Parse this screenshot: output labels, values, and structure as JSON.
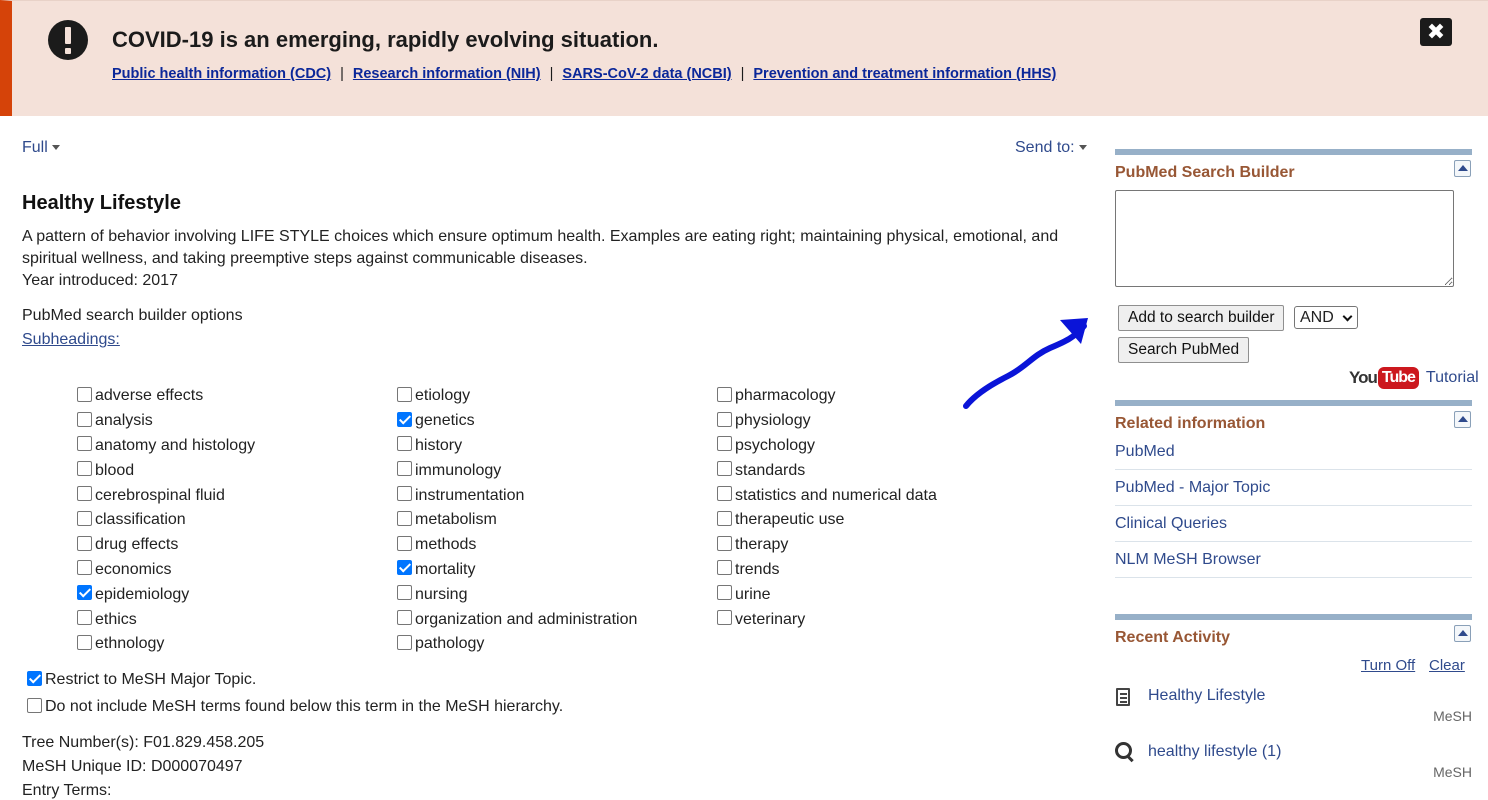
{
  "banner": {
    "title": "COVID-19 is an emerging, rapidly evolving situation.",
    "links": [
      "Public health information (CDC)",
      "Research information (NIH)",
      "SARS-CoV-2 data (NCBI)",
      "Prevention and treatment information (HHS)"
    ],
    "separator": "|",
    "close_label": "✖",
    "accent_color": "#d54309",
    "background_color": "#f4e1d9"
  },
  "toolbar": {
    "format_label": "Full",
    "send_to_label": "Send to:"
  },
  "record": {
    "title": "Healthy Lifestyle",
    "description": "A pattern of behavior involving LIFE STYLE choices which ensure optimum health. Examples are eating right; maintaining physical, emotional, and spiritual wellness, and taking preemptive steps against communicable diseases.",
    "year_introduced": "Year introduced: 2017",
    "builder_options_label": "PubMed search builder options",
    "subheadings_label": "Subheadings:",
    "subheadings": [
      [
        {
          "label": "adverse effects",
          "checked": false
        },
        {
          "label": "analysis",
          "checked": false
        },
        {
          "label": "anatomy and histology",
          "checked": false
        },
        {
          "label": "blood",
          "checked": false
        },
        {
          "label": "cerebrospinal fluid",
          "checked": false
        },
        {
          "label": "classification",
          "checked": false
        },
        {
          "label": "drug effects",
          "checked": false
        },
        {
          "label": "economics",
          "checked": false
        },
        {
          "label": "epidemiology",
          "checked": true
        },
        {
          "label": "ethics",
          "checked": false
        },
        {
          "label": "ethnology",
          "checked": false
        }
      ],
      [
        {
          "label": "etiology",
          "checked": false
        },
        {
          "label": "genetics",
          "checked": true
        },
        {
          "label": "history",
          "checked": false
        },
        {
          "label": "immunology",
          "checked": false
        },
        {
          "label": "instrumentation",
          "checked": false
        },
        {
          "label": "metabolism",
          "checked": false
        },
        {
          "label": "methods",
          "checked": false
        },
        {
          "label": "mortality",
          "checked": true
        },
        {
          "label": "nursing",
          "checked": false
        },
        {
          "label": "organization and administration",
          "checked": false
        },
        {
          "label": "pathology",
          "checked": false
        }
      ],
      [
        {
          "label": "pharmacology",
          "checked": false
        },
        {
          "label": "physiology",
          "checked": false
        },
        {
          "label": "psychology",
          "checked": false
        },
        {
          "label": "standards",
          "checked": false
        },
        {
          "label": "statistics and numerical data",
          "checked": false
        },
        {
          "label": "therapeutic use",
          "checked": false
        },
        {
          "label": "therapy",
          "checked": false
        },
        {
          "label": "trends",
          "checked": false
        },
        {
          "label": "urine",
          "checked": false
        },
        {
          "label": "veterinary",
          "checked": false
        }
      ]
    ],
    "restrict_major_topic": {
      "label": "Restrict to MeSH Major Topic.",
      "checked": true
    },
    "exclude_below": {
      "label": "Do not include MeSH terms found below this term in the MeSH hierarchy.",
      "checked": false
    },
    "tree_number": "Tree Number(s): F01.829.458.205",
    "unique_id": "MeSH Unique ID: D000070497",
    "entry_terms_partial": "Entry Terms:"
  },
  "sidebar": {
    "search_builder": {
      "title": "PubMed Search Builder",
      "textarea_value": "",
      "add_button": "Add to search builder",
      "operator": "AND",
      "search_button": "Search PubMed",
      "youtube_you": "You",
      "youtube_tube": "Tube",
      "tutorial_label": "Tutorial"
    },
    "related": {
      "title": "Related information",
      "links": [
        "PubMed",
        "PubMed - Major Topic",
        "Clinical Queries",
        "NLM MeSH Browser"
      ]
    },
    "recent": {
      "title": "Recent Activity",
      "turn_off": "Turn Off",
      "clear": "Clear",
      "items": [
        {
          "icon": "document-icon",
          "label": "Healthy Lifestyle",
          "db": "MeSH"
        },
        {
          "icon": "search-icon",
          "label": "healthy lifestyle (1)",
          "db": "MeSH"
        }
      ]
    },
    "portlet_bar_color": "#97b0c8",
    "portlet_title_color": "#985735",
    "link_color": "#2f4a8c"
  },
  "annotation": {
    "arrow_color": "#0a14d8"
  }
}
